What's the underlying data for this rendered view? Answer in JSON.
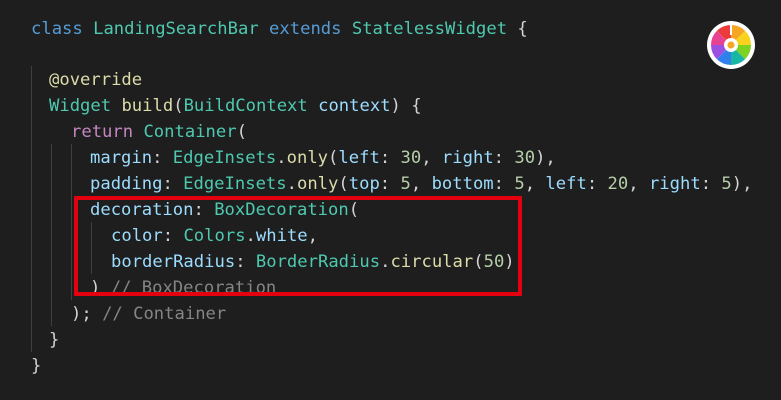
{
  "code": {
    "line1": {
      "kw1": "class",
      "name": "LandingSearchBar",
      "kw2": "extends",
      "base": "StatelessWidget",
      "brace": " {"
    },
    "line3": {
      "annotation": "@override"
    },
    "line4": {
      "type": "Widget",
      "method": "build",
      "open": "(",
      "paramType": "BuildContext",
      "paramName": "context",
      "close": ") {"
    },
    "line5": {
      "kw": "return",
      "cls": "Container",
      "open": "("
    },
    "line6": {
      "prop": "margin",
      "colon": ": ",
      "cls": "EdgeInsets",
      "dot": ".",
      "fn": "only",
      "open": "(",
      "p1": "left",
      "c1": ": ",
      "v1": "30",
      "sep1": ", ",
      "p2": "right",
      "c2": ": ",
      "v2": "30",
      "close": "),"
    },
    "line7": {
      "prop": "padding",
      "colon": ": ",
      "cls": "EdgeInsets",
      "dot": ".",
      "fn": "only",
      "open": "(",
      "p1": "top",
      "c1": ": ",
      "v1": "5",
      "sep1": ", ",
      "p2": "bottom",
      "c2": ": ",
      "v2": "5",
      "sep2": ", ",
      "p3": "left",
      "c3": ": ",
      "v3": "20",
      "sep3": ", ",
      "p4": "right",
      "c4": ": ",
      "v4": "5",
      "close": "),"
    },
    "line8": {
      "prop": "decoration",
      "colon": ": ",
      "cls": "BoxDecoration",
      "open": "("
    },
    "line9": {
      "prop": "color",
      "colon": ": ",
      "cls": "Colors",
      "dot": ".",
      "value": "white",
      "comma": ","
    },
    "line10": {
      "prop": "borderRadius",
      "colon": ": ",
      "cls": "BorderRadius",
      "dot": ".",
      "fn": "circular",
      "open": "(",
      "v": "50",
      "close": ")"
    },
    "line11": {
      "close": ")",
      "comment": "// BoxDecoration"
    },
    "line12": {
      "close": ");",
      "comment": "// Container"
    },
    "line13": {
      "close": "}"
    },
    "line14": {
      "close": "}"
    }
  },
  "highlight": {
    "color": "#e3000f"
  },
  "logo": {
    "icon": "color-wheel-icon"
  }
}
